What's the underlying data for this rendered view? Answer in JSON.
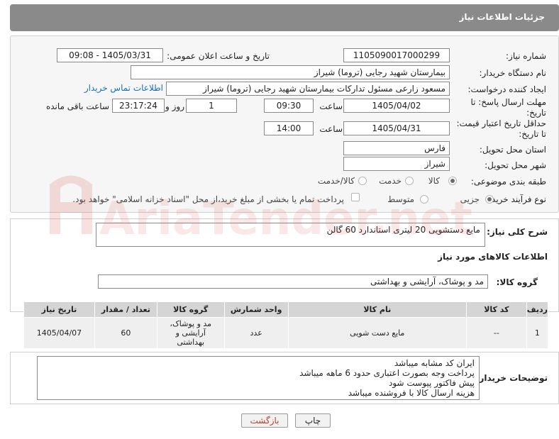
{
  "header": {
    "title": "جزئیات اطلاعات نیاز"
  },
  "form": {
    "need_number_label": "شماره نیاز:",
    "need_number": "1105090017000299",
    "announce_label": "تاریخ و ساعت اعلان عمومی:",
    "announce_value": "1405/03/31 - 09:08",
    "buyer_org_label": "نام دستگاه خریدار:",
    "buyer_org": "بیمارستان شهید رجایی (تروما) شیراز",
    "creator_label": "ایجاد کننده درخواست:",
    "creator": "مسعود زارعی مسئول تدارکات بیمارستان شهید رجایی (تروما) شیراز",
    "contact_link": "اطلاعات تماس خریدار",
    "send_deadline_label": "مهلت ارسال پاسخ: تا تاریخ:",
    "send_date": "1405/04/02",
    "time_label": "ساعت",
    "send_time": "09:30",
    "days_value": "1",
    "days_label": "روز و",
    "remaining_time": "23:17:24",
    "remaining_label": "ساعت باقی مانده",
    "price_deadline_label": "حداقل تاریخ اعتبار قیمت: تا تاریخ:",
    "price_date": "1405/04/31",
    "price_time": "14:00",
    "province_label": "استان محل تحویل:",
    "province": "فارس",
    "city_label": "شهر محل تحویل:",
    "city": "شیراز",
    "category_label": "طبقه بندی موضوعی:",
    "category_options": [
      "کالا",
      "خدمت",
      "کالا/خدمت"
    ],
    "process_label": "نوع فرآیند خرید :",
    "process_options": [
      "جزیی",
      "متوسط"
    ],
    "payment_note": "پرداخت تمام یا بخشی از مبلغ خرید،از محل \"اسناد خزانه اسلامی\" خواهد بود."
  },
  "description": {
    "label": "شرح کلی نیاز:",
    "value": "مایع دستشویی 20 لیتری استاندارد 60 گالن"
  },
  "goods": {
    "title": "اطلاعات کالاهای مورد نیاز",
    "group_label": "گروه کالا:",
    "group_value": "مد و پوشاک، آرایشی و بهداشتی",
    "columns": [
      "ردیف",
      "کد کالا",
      "نام کالا",
      "واحد شمارش",
      "گروه کالا",
      "تعداد / مقدار",
      "تاریخ نیاز"
    ],
    "rows": [
      [
        "1",
        "--",
        "مایع دست شویی",
        "عدد",
        "مد و پوشاک، آرایشی و بهداشتی",
        "60",
        "1405/04/07"
      ]
    ]
  },
  "buyer_notes": {
    "label": "توضیحات خریدار:",
    "lines": [
      "ایران کد مشابه میباشد",
      "پرداخت وجه بصورت اعتباری حدود 6 ماهه میباشد",
      "پیش فاکتور پیوست شود",
      "هزینه ارسال کالا با فروشنده میباشد"
    ]
  },
  "buttons": {
    "print": "چاپ",
    "back": "بازگشت"
  },
  "watermark": {
    "text": "AriaTender.net"
  },
  "colors": {
    "header_bg": "#8a8a8a",
    "link": "#1a6fb5",
    "back_text": "#c0392b",
    "watermark": "#d9534f"
  }
}
